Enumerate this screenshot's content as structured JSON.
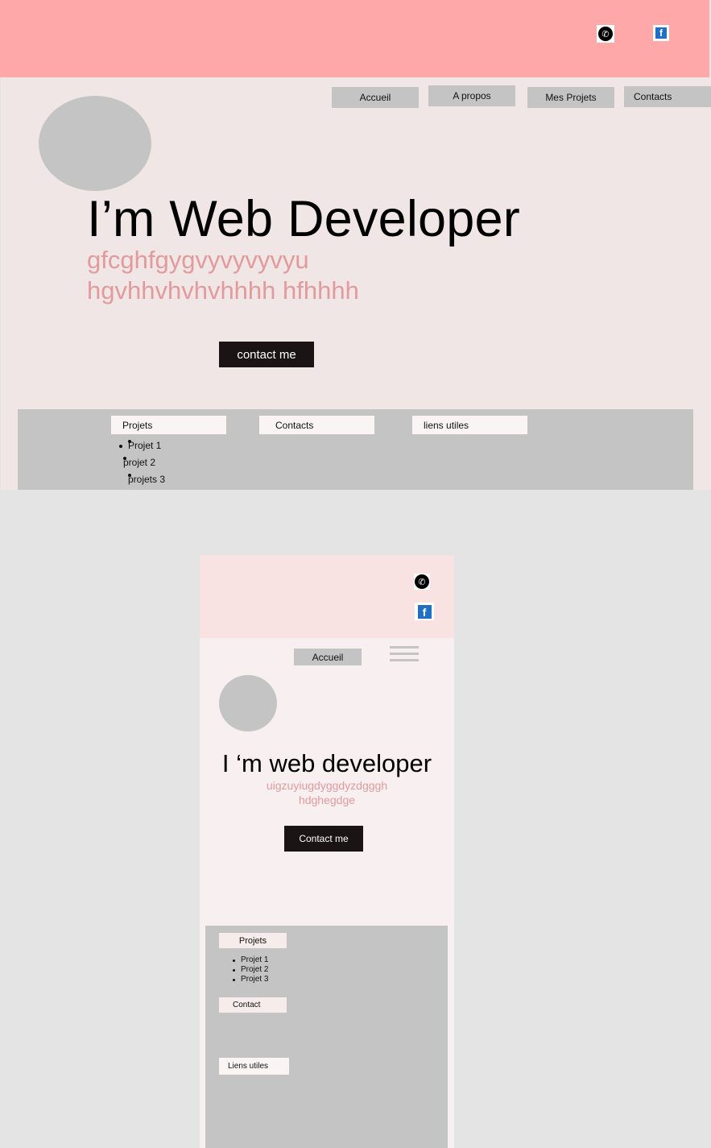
{
  "desktop": {
    "social": {
      "whatsapp_icon": "whatsapp-icon",
      "facebook_icon": "facebook-icon",
      "facebook_glyph": "f"
    },
    "nav": [
      "Accueil",
      "A propos",
      "Mes Projets",
      "Contacts"
    ],
    "hero": {
      "title": "I’m Web Developer",
      "subtitle_line1": "gfcghfgygvyvyvyvyu",
      "subtitle_line2": "hgvhhvhvhvhhhh hfhhhh",
      "cta": "contact me"
    },
    "footer": {
      "tabs": [
        "Projets",
        "Contacts",
        "liens utiles"
      ],
      "projects": [
        "Projet 1",
        "projet 2",
        "projets 3"
      ]
    }
  },
  "mobile": {
    "social": {
      "whatsapp_icon": "whatsapp-icon",
      "facebook_icon": "facebook-icon",
      "facebook_glyph": "f"
    },
    "nav": {
      "home": "Accueil",
      "menu_icon": "hamburger-menu-icon"
    },
    "hero": {
      "title": "I ‘m web developer",
      "subtitle_line1": "uigzuyiugdyggdyzdgggh",
      "subtitle_line2": "hdghegdge",
      "cta": "Contact me"
    },
    "footer": {
      "projects_tab": "Projets",
      "projects": [
        "Projet 1",
        "Projet 2",
        "Projet 3"
      ],
      "contact_tab": "Contact",
      "links_tab": "Liens utiles"
    }
  },
  "colors": {
    "desktop_header": "#ffa8a9",
    "mobile_header": "#f8e2e2",
    "page_bg": "#f1e6e6",
    "accent_text": "#e29a9c",
    "placeholder_gray": "#c4c4c4",
    "button_dark": "#1a1414"
  }
}
